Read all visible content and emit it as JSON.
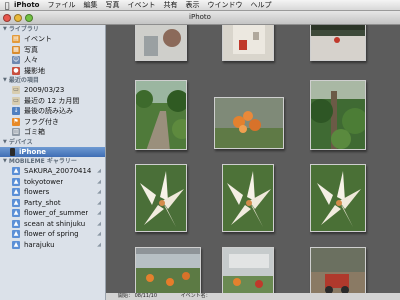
{
  "menubar": {
    "app_name": "iPhoto",
    "items": [
      "ファイル",
      "編集",
      "写真",
      "イベント",
      "共有",
      "表示",
      "ウインドウ",
      "ヘルプ"
    ]
  },
  "window": {
    "title": "iPhoto"
  },
  "sidebar": {
    "library_header": "ライブラリ",
    "library_items": [
      {
        "label": "イベント",
        "icon": "events-icon",
        "color": "#e39a3a"
      },
      {
        "label": "写真",
        "icon": "photos-icon",
        "color": "#d98c2e"
      },
      {
        "label": "人々",
        "icon": "people-icon",
        "color": "#6e88b0"
      },
      {
        "label": "撮影地",
        "icon": "places-icon",
        "color": "#c84f3e"
      }
    ],
    "recent_header": "最近の項目",
    "recent_items": [
      {
        "label": "2009/03/23",
        "icon": "calendar-icon",
        "color": "#d8cdb0"
      },
      {
        "label": "最近の 12 カ月間",
        "icon": "calendar-icon",
        "color": "#d8cdb0"
      },
      {
        "label": "最後の読み込み",
        "icon": "import-icon",
        "color": "#4f7fc0"
      },
      {
        "label": "フラグ付き",
        "icon": "flag-icon",
        "color": "#e88a28"
      },
      {
        "label": "ゴミ箱",
        "icon": "trash-icon",
        "color": "#8e98a4"
      }
    ],
    "devices_header": "デバイス",
    "device_item": {
      "label": "iPhone",
      "icon": "iphone-icon"
    },
    "gallery_header": "MOBILEME ギャラリー",
    "gallery_items": [
      {
        "label": "SAKURA_20070414"
      },
      {
        "label": "tokyotower"
      },
      {
        "label": "flowers"
      },
      {
        "label": "Party_shot"
      },
      {
        "label": "flower_of_summer"
      },
      {
        "label": "scean at shinjuku"
      },
      {
        "label": "flower of spring"
      },
      {
        "label": "harajuku"
      }
    ],
    "gallery_icon_color": "#5b8fd6"
  },
  "statusbar": {
    "start_text": "開始： 08/11/10",
    "event_text": "イベント名："
  }
}
